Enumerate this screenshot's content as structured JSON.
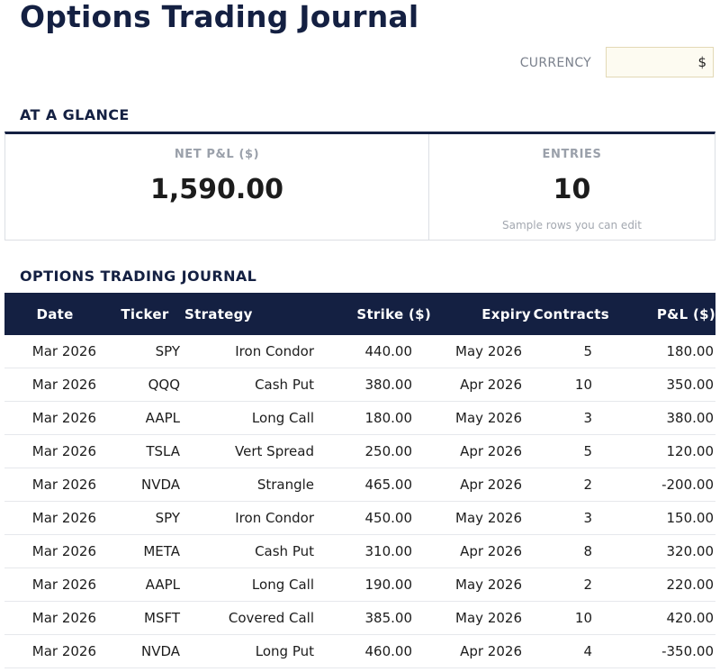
{
  "page": {
    "title": "Options Trading Journal"
  },
  "settings": {
    "currency_label": "CURRENCY",
    "currency_value": "$"
  },
  "glance": {
    "heading": "AT A GLANCE",
    "net_pl": {
      "label": "NET P&L ($)",
      "value": "1,590.00"
    },
    "entries": {
      "label": "ENTRIES",
      "value": "10",
      "note": "Sample rows you can edit"
    }
  },
  "journal": {
    "heading": "OPTIONS TRADING JOURNAL",
    "columns": [
      "Date",
      "Ticker",
      "Strategy",
      "Strike ($)",
      "Expiry",
      "Contracts",
      "P&L ($)"
    ],
    "rows": [
      [
        "Mar 2026",
        "SPY",
        "Iron Condor",
        "440.00",
        "May 2026",
        "5",
        "180.00"
      ],
      [
        "Mar 2026",
        "QQQ",
        "Cash Put",
        "380.00",
        "Apr 2026",
        "10",
        "350.00"
      ],
      [
        "Mar 2026",
        "AAPL",
        "Long Call",
        "180.00",
        "May 2026",
        "3",
        "380.00"
      ],
      [
        "Mar 2026",
        "TSLA",
        "Vert Spread",
        "250.00",
        "Apr 2026",
        "5",
        "120.00"
      ],
      [
        "Mar 2026",
        "NVDA",
        "Strangle",
        "465.00",
        "Apr 2026",
        "2",
        "-200.00"
      ],
      [
        "Mar 2026",
        "SPY",
        "Iron Condor",
        "450.00",
        "May 2026",
        "3",
        "150.00"
      ],
      [
        "Mar 2026",
        "META",
        "Cash Put",
        "310.00",
        "Apr 2026",
        "8",
        "320.00"
      ],
      [
        "Mar 2026",
        "AAPL",
        "Long Call",
        "190.00",
        "May 2026",
        "2",
        "220.00"
      ],
      [
        "Mar 2026",
        "MSFT",
        "Covered Call",
        "385.00",
        "May 2026",
        "10",
        "420.00"
      ],
      [
        "Mar 2026",
        "NVDA",
        "Long Put",
        "460.00",
        "Apr 2026",
        "4",
        "-350.00"
      ]
    ]
  },
  "colors": {
    "navy": "#142042",
    "currency_input_bg": "#fdfbf1",
    "muted_label": "#9aa0aa",
    "row_divider": "#e6e8ec"
  }
}
